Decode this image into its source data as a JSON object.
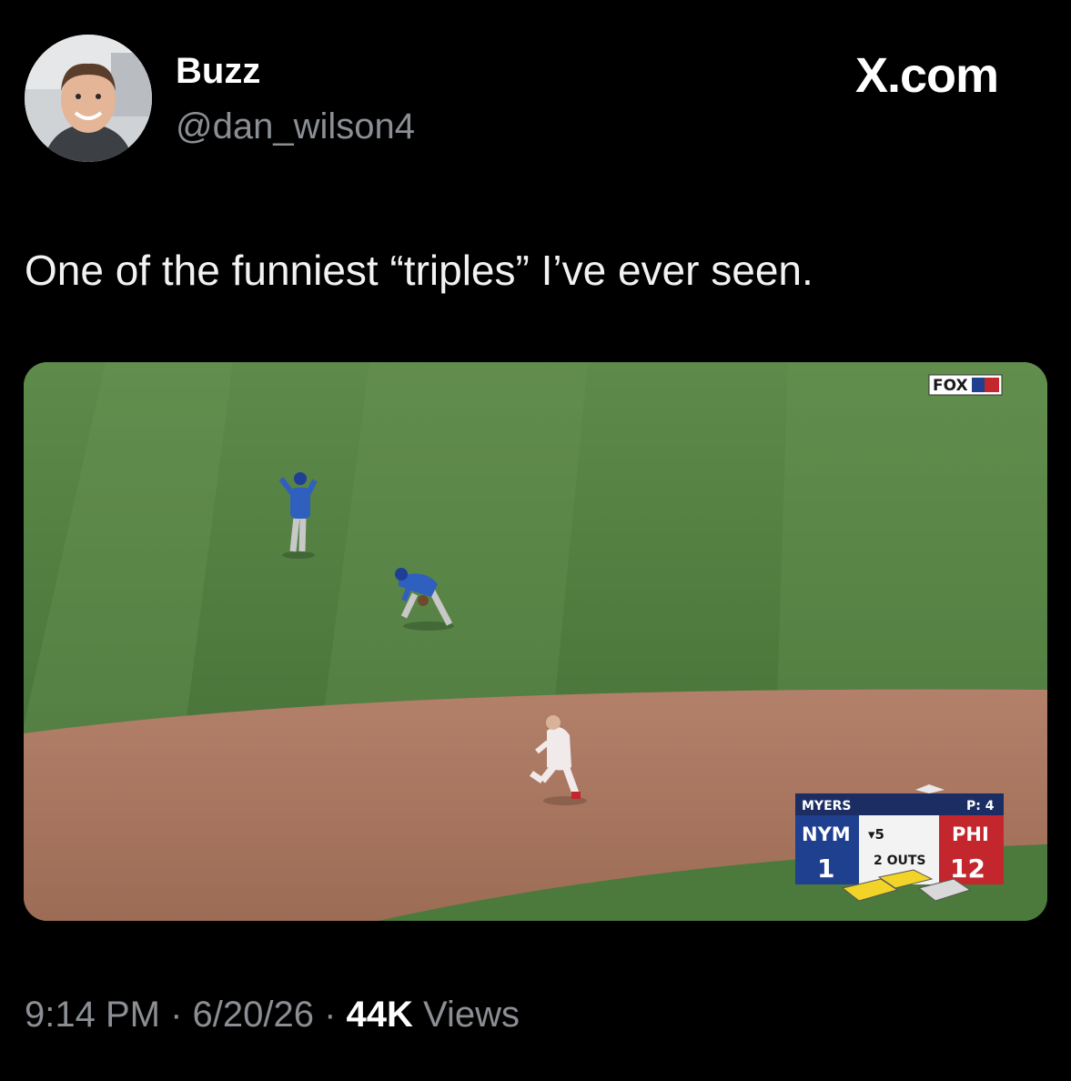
{
  "author": {
    "name": "Buzz",
    "handle": "@dan_wilson4"
  },
  "brand": "X.com",
  "tweet": {
    "text": "One of the funniest “triples” I’ve ever seen."
  },
  "media": {
    "broadcaster_logo": "FOX",
    "scoreboard": {
      "batter": "MYERS",
      "pitch_count": "P: 4",
      "away_team": "NYM",
      "away_score": "1",
      "inning": "▾5",
      "outs": "2 OUTS",
      "home_team": "PHI",
      "home_score": "12"
    }
  },
  "meta": {
    "time": "9:14 PM",
    "date": "6/20/26",
    "views_count": "44K",
    "views_label": "Views"
  },
  "colors": {
    "background": "#000000",
    "muted_text": "#8b8f94",
    "grass": "#4f7d3f",
    "infield_dirt": "#a8765a",
    "away_blue": "#1f3f8f",
    "home_red": "#c3262d"
  },
  "icons": [
    "avatar-photo"
  ]
}
